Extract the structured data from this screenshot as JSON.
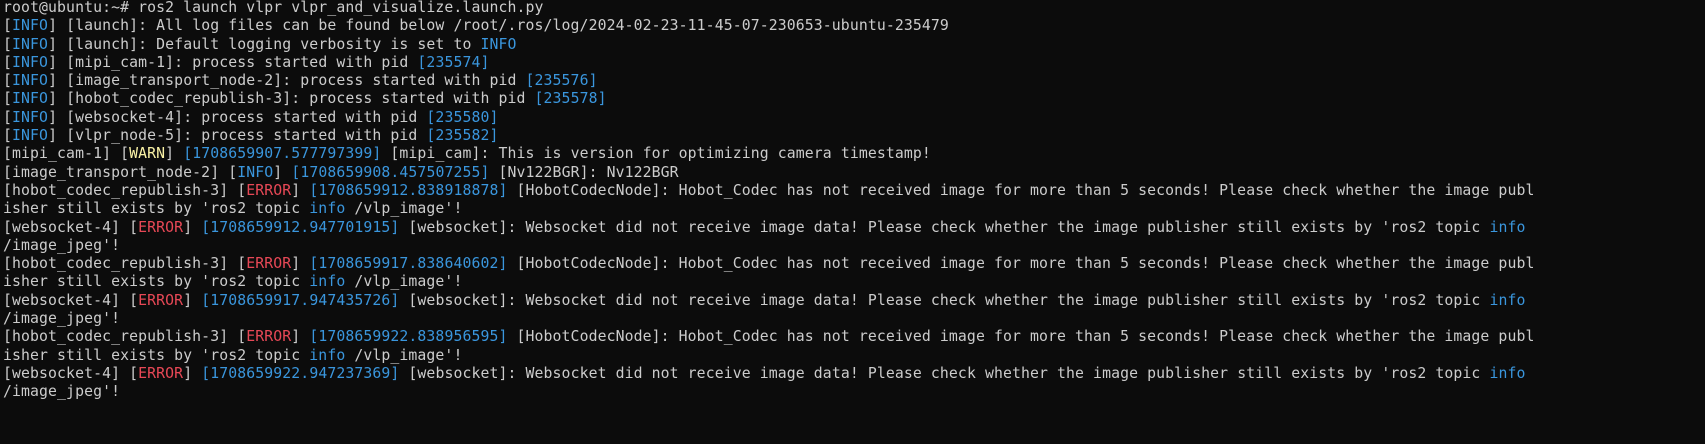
{
  "colors": {
    "background": "#0c0c0c",
    "text": "#cccccc",
    "info": "#3a96dd",
    "warn": "#f9f1a5",
    "error": "#e74856"
  },
  "terminal": {
    "lines": [
      [
        {
          "t": "root@ubuntu:~# ros2 launch vlpr vlpr_and_visualize.launch.py",
          "c": "default"
        }
      ],
      [
        {
          "t": "[",
          "c": "default"
        },
        {
          "t": "INFO",
          "c": "cyan"
        },
        {
          "t": "] [launch]: All log files can be found below /root/.ros/log/2024-02-23-11-45-07-230653-ubuntu-235479",
          "c": "default"
        }
      ],
      [
        {
          "t": "[",
          "c": "default"
        },
        {
          "t": "INFO",
          "c": "cyan"
        },
        {
          "t": "] [launch]: Default logging verbosity is set to ",
          "c": "default"
        },
        {
          "t": "INFO",
          "c": "cyan"
        }
      ],
      [
        {
          "t": "[",
          "c": "default"
        },
        {
          "t": "INFO",
          "c": "cyan"
        },
        {
          "t": "] [mipi_cam-1]: process started with pid ",
          "c": "default"
        },
        {
          "t": "[235574]",
          "c": "cyan"
        }
      ],
      [
        {
          "t": "[",
          "c": "default"
        },
        {
          "t": "INFO",
          "c": "cyan"
        },
        {
          "t": "] [image_transport_node-2]: process started with pid ",
          "c": "default"
        },
        {
          "t": "[235576]",
          "c": "cyan"
        }
      ],
      [
        {
          "t": "[",
          "c": "default"
        },
        {
          "t": "INFO",
          "c": "cyan"
        },
        {
          "t": "] [hobot_codec_republish-3]: process started with pid ",
          "c": "default"
        },
        {
          "t": "[235578]",
          "c": "cyan"
        }
      ],
      [
        {
          "t": "[",
          "c": "default"
        },
        {
          "t": "INFO",
          "c": "cyan"
        },
        {
          "t": "] [websocket-4]: process started with pid ",
          "c": "default"
        },
        {
          "t": "[235580]",
          "c": "cyan"
        }
      ],
      [
        {
          "t": "[",
          "c": "default"
        },
        {
          "t": "INFO",
          "c": "cyan"
        },
        {
          "t": "] [vlpr_node-5]: process started with pid ",
          "c": "default"
        },
        {
          "t": "[235582]",
          "c": "cyan"
        }
      ],
      [
        {
          "t": "[mipi_cam-1] [",
          "c": "default"
        },
        {
          "t": "WARN",
          "c": "yellow"
        },
        {
          "t": "] ",
          "c": "default"
        },
        {
          "t": "[1708659907.577797399]",
          "c": "cyan"
        },
        {
          "t": " [mipi_cam]: This is version for optimizing camera timestamp!",
          "c": "default"
        }
      ],
      [
        {
          "t": "[image_transport_node-2] [",
          "c": "default"
        },
        {
          "t": "INFO",
          "c": "cyan"
        },
        {
          "t": "] ",
          "c": "default"
        },
        {
          "t": "[1708659908.457507255]",
          "c": "cyan"
        },
        {
          "t": " [Nv122BGR]: Nv122BGR",
          "c": "default"
        }
      ],
      [
        {
          "t": "[hobot_codec_republish-3] [",
          "c": "default"
        },
        {
          "t": "ERROR",
          "c": "red"
        },
        {
          "t": "] ",
          "c": "default"
        },
        {
          "t": "[1708659912.838918878]",
          "c": "cyan"
        },
        {
          "t": " [HobotCodecNode]: Hobot_Codec has not received image for more than 5 seconds! Please check whether the image publ",
          "c": "default"
        }
      ],
      [
        {
          "t": "isher still exists by 'ros2 topic ",
          "c": "default"
        },
        {
          "t": "info",
          "c": "cyan"
        },
        {
          "t": " /vlp_image'!",
          "c": "default"
        }
      ],
      [
        {
          "t": "[websocket-4] [",
          "c": "default"
        },
        {
          "t": "ERROR",
          "c": "red"
        },
        {
          "t": "] ",
          "c": "default"
        },
        {
          "t": "[1708659912.947701915]",
          "c": "cyan"
        },
        {
          "t": " [websocket]: Websocket did not receive image data! Please check whether the image publisher still exists by 'ros2 topic ",
          "c": "default"
        },
        {
          "t": "info",
          "c": "cyan"
        }
      ],
      [
        {
          "t": "/image_jpeg'!",
          "c": "default"
        }
      ],
      [
        {
          "t": "[hobot_codec_republish-3] [",
          "c": "default"
        },
        {
          "t": "ERROR",
          "c": "red"
        },
        {
          "t": "] ",
          "c": "default"
        },
        {
          "t": "[1708659917.838640602]",
          "c": "cyan"
        },
        {
          "t": " [HobotCodecNode]: Hobot_Codec has not received image for more than 5 seconds! Please check whether the image publ",
          "c": "default"
        }
      ],
      [
        {
          "t": "isher still exists by 'ros2 topic ",
          "c": "default"
        },
        {
          "t": "info",
          "c": "cyan"
        },
        {
          "t": " /vlp_image'!",
          "c": "default"
        }
      ],
      [
        {
          "t": "[websocket-4] [",
          "c": "default"
        },
        {
          "t": "ERROR",
          "c": "red"
        },
        {
          "t": "] ",
          "c": "default"
        },
        {
          "t": "[1708659917.947435726]",
          "c": "cyan"
        },
        {
          "t": " [websocket]: Websocket did not receive image data! Please check whether the image publisher still exists by 'ros2 topic ",
          "c": "default"
        },
        {
          "t": "info",
          "c": "cyan"
        }
      ],
      [
        {
          "t": "/image_jpeg'!",
          "c": "default"
        }
      ],
      [
        {
          "t": "[hobot_codec_republish-3] [",
          "c": "default"
        },
        {
          "t": "ERROR",
          "c": "red"
        },
        {
          "t": "] ",
          "c": "default"
        },
        {
          "t": "[1708659922.838956595]",
          "c": "cyan"
        },
        {
          "t": " [HobotCodecNode]: Hobot_Codec has not received image for more than 5 seconds! Please check whether the image publ",
          "c": "default"
        }
      ],
      [
        {
          "t": "isher still exists by 'ros2 topic ",
          "c": "default"
        },
        {
          "t": "info",
          "c": "cyan"
        },
        {
          "t": " /vlp_image'!",
          "c": "default"
        }
      ],
      [
        {
          "t": "[websocket-4] [",
          "c": "default"
        },
        {
          "t": "ERROR",
          "c": "red"
        },
        {
          "t": "] ",
          "c": "default"
        },
        {
          "t": "[1708659922.947237369]",
          "c": "cyan"
        },
        {
          "t": " [websocket]: Websocket did not receive image data! Please check whether the image publisher still exists by 'ros2 topic ",
          "c": "default"
        },
        {
          "t": "info",
          "c": "cyan"
        }
      ],
      [
        {
          "t": "/image_jpeg'!",
          "c": "default"
        }
      ]
    ]
  }
}
